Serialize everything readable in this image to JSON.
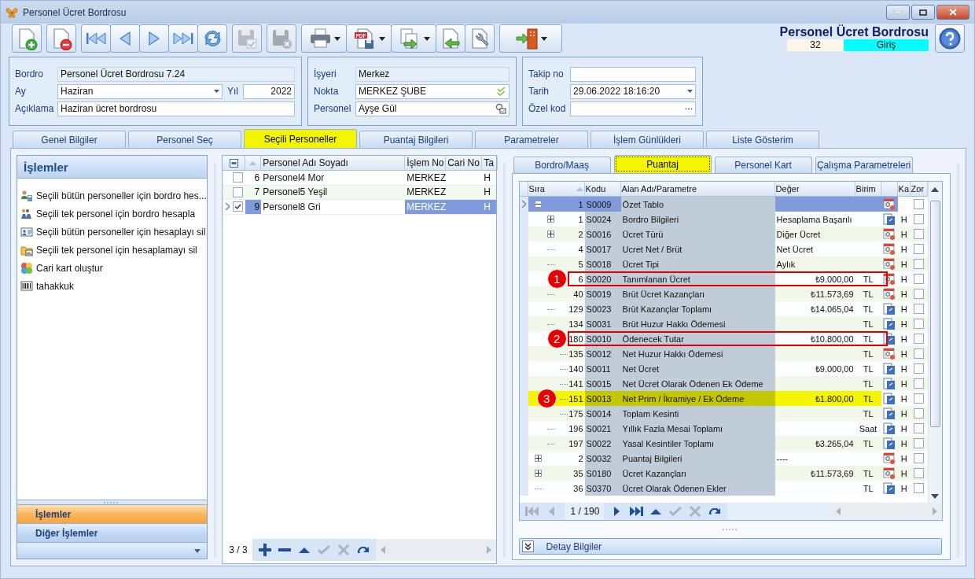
{
  "window": {
    "title": "Personel Ücret Bordrosu"
  },
  "toolbar": [
    [
      {
        "kind": "new",
        "disabled": false
      }
    ],
    [
      {
        "kind": "delete",
        "disabled": false
      }
    ],
    [
      {
        "kind": "first",
        "disabled": false
      },
      {
        "kind": "prev",
        "disabled": false
      },
      {
        "kind": "next",
        "disabled": false
      },
      {
        "kind": "last",
        "disabled": false
      },
      {
        "kind": "refresh",
        "disabled": false
      }
    ],
    [
      {
        "kind": "save",
        "disabled": true
      }
    ],
    [
      {
        "kind": "discard",
        "disabled": true
      }
    ],
    [
      {
        "kind": "print",
        "disabled": false,
        "dropdown": true
      },
      {
        "kind": "pdf",
        "disabled": false,
        "dropdown": true,
        "badge": "PDF"
      },
      {
        "kind": "export",
        "disabled": false,
        "dropdown": true
      },
      {
        "kind": "import",
        "disabled": false
      },
      {
        "kind": "tools",
        "disabled": false
      }
    ],
    [
      {
        "kind": "exit",
        "disabled": false,
        "dropdown": true
      }
    ]
  ],
  "header": {
    "title": "Personel Ücret Bordrosu",
    "record": "32",
    "mode": "Giriş"
  },
  "form_panels": [
    {
      "rows": [
        [
          {
            "label": "Bordro",
            "value": "Personel Ücret Bordrosu 7.24",
            "kind": "readonly"
          }
        ],
        [
          {
            "label": "Ay",
            "value": "Haziran",
            "kind": "dropdown"
          },
          {
            "label": "Yıl",
            "value": "2022",
            "kind": "number"
          }
        ],
        [
          {
            "label": "Açıklama",
            "value": "Haziran ücret bordrosu",
            "kind": "text"
          }
        ]
      ]
    },
    {
      "rows": [
        [
          {
            "label": "İşyeri",
            "value": "Merkez",
            "kind": "readonly"
          }
        ],
        [
          {
            "label": "Nokta",
            "value": "MERKEZ ŞUBE",
            "kind": "check"
          }
        ],
        [
          {
            "label": "Personel",
            "value": "Ayşe Gül",
            "kind": "lookup"
          }
        ]
      ]
    },
    {
      "rows": [
        [
          {
            "label": "Takip no",
            "kind": "text"
          }
        ],
        [
          {
            "label": "Tarih",
            "value": "29.06.2022 18:16:20",
            "kind": "dropdown"
          }
        ],
        [
          {
            "label": "Özel kod",
            "kind": "ellipsis"
          }
        ]
      ]
    }
  ],
  "tabs": [
    {
      "label": "Genel Bilgiler",
      "selected": false
    },
    {
      "label": "Personel Seç",
      "selected": false
    },
    {
      "label": "Seçili Personeller",
      "selected": true
    },
    {
      "label": "Puantaj Bilgileri",
      "selected": false
    },
    {
      "label": "Parametreler",
      "selected": false
    },
    {
      "label": "İşlem Günlükleri",
      "selected": false
    },
    {
      "label": "Liste Gösterim",
      "selected": false
    }
  ],
  "actions_panel": {
    "title": "İşlemler",
    "items": [
      "Seçili bütün personeller için bordro hes...",
      "Seçili tek personel için bordro hesapla",
      "Seçili bütün personeller için hesaplayı sil",
      "Seçili tek personel için hesaplamayı sil",
      "Cari kart oluştur",
      "tahakkuk"
    ],
    "groups": [
      {
        "label": "İşlemler",
        "selected": true
      },
      {
        "label": "Diğer İşlemler",
        "selected": false
      }
    ]
  },
  "personnel_grid": {
    "columns": [
      "Personel Adı Soyadı",
      "İşlem No",
      "Cari No",
      "Ta"
    ],
    "rows": [
      {
        "checked": false,
        "selected": false,
        "number": "6",
        "name": "Personel4 Mor",
        "point": "MERKEZ",
        "column_6": "H"
      },
      {
        "checked": false,
        "selected": false,
        "number": "7",
        "name": "Personel5 Yeşil",
        "point": "MERKEZ",
        "column_6": "H"
      },
      {
        "checked": true,
        "selected": true,
        "number": "9",
        "name": "Personel8 Gri",
        "point": "MERKEZ",
        "column_6": "H"
      }
    ],
    "pager": "3 / 3",
    "nav": [
      {
        "kind": "add",
        "disabled": false
      },
      {
        "kind": "remove",
        "disabled": false
      },
      {
        "kind": "up",
        "disabled": false
      },
      {
        "kind": "post",
        "disabled": true
      },
      {
        "kind": "cancel",
        "disabled": true
      },
      {
        "kind": "redo",
        "disabled": false
      }
    ]
  },
  "subtabs": [
    {
      "label": "Bordro/Maaş",
      "selected": false
    },
    {
      "label": "Puantaj",
      "selected": true
    },
    {
      "label": "Personel Kart",
      "selected": false
    },
    {
      "label": "Çalışma Parametreleri",
      "selected": false
    }
  ],
  "puantaj_grid": {
    "columns": [
      "Sıra",
      "Kodu",
      "Alan Adı/Parametre",
      "Değer",
      "Birim",
      "Ka",
      "Zor"
    ],
    "rows": [
      {
        "sira": "1",
        "code": "S0009",
        "name": "Özet Tablo",
        "kind": "calendar",
        "checked": false,
        "selected": true,
        "expanded": true,
        "children": [
          {
            "sira": "1",
            "code": "S0024",
            "name": "Bordro Bilgileri",
            "value": "Hesaplama Başarılı",
            "kind": "sheet",
            "ka": "H",
            "checked": false,
            "selected": false,
            "expanded": false
          },
          {
            "sira": "2",
            "code": "S0016",
            "name": "Ücret Türü",
            "value": "Diğer Ücret",
            "kind": "calendar",
            "ka": "H",
            "checked": false,
            "selected": false,
            "expanded": false
          },
          {
            "sira": "4",
            "code": "S0017",
            "name": "Ucret Net / Brüt",
            "value": "Net Ücret",
            "kind": "calendar",
            "ka": "H",
            "checked": false,
            "selected": false
          },
          {
            "sira": "5",
            "code": "S0018",
            "name": "Ücret Tipi",
            "value": "Aylık",
            "kind": "calendar",
            "ka": "H",
            "checked": false,
            "selected": false
          },
          {
            "sira": "6",
            "code": "S0020",
            "name": "Tanımlanan Ücret",
            "value": "₺9.000,00",
            "unit": "TL",
            "kind": "calendar",
            "ka": "H",
            "checked": false,
            "selected": false,
            "callout": "1",
            "outlined": true,
            "highlighted": false
          },
          {
            "sira": "40",
            "code": "S0019",
            "name": "Brüt Ücret Kazançları",
            "value": "₺11.573,69",
            "unit": "TL",
            "kind": "calendar",
            "ka": "H",
            "checked": false,
            "selected": false
          },
          {
            "sira": "129",
            "code": "S0023",
            "name": "Brüt Kazançlar Toplamı",
            "value": "₺14.065,04",
            "unit": "TL",
            "kind": "sheet",
            "ka": "H",
            "checked": false,
            "selected": false
          },
          {
            "sira": "134",
            "code": "S0031",
            "name": "Brüt Huzur Hakkı Ödemesi",
            "unit": "TL",
            "kind": "sheet",
            "ka": "H",
            "checked": false,
            "selected": false
          },
          {
            "sira": "180",
            "code": "S0010",
            "name": "Ödenecek Tutar",
            "value": "₺10.800,00",
            "unit": "TL",
            "kind": "sheet",
            "ka": "H",
            "checked": false,
            "selected": false,
            "callout": "2",
            "outlined": true,
            "highlighted": false,
            "children": [
              {
                "sira": "135",
                "code": "S0012",
                "name": "Net Huzur Hakkı Ödemesi",
                "unit": "TL",
                "kind": "calendar",
                "ka": "H",
                "checked": false,
                "selected": false
              },
              {
                "sira": "140",
                "code": "S0011",
                "name": "Net Ücret",
                "value": "₺9.000,00",
                "unit": "TL",
                "kind": "sheet",
                "ka": "H",
                "checked": false,
                "selected": false
              },
              {
                "sira": "141",
                "code": "S0015",
                "name": "Net Ücret Olarak Ödenen Ek Ödeme",
                "unit": "TL",
                "kind": "sheet",
                "ka": "H",
                "checked": false,
                "selected": false
              },
              {
                "sira": "151",
                "code": "S0013",
                "name": "Net Prim / İkramiye / Ek Ödeme",
                "value": "₺1.800,00",
                "unit": "TL",
                "kind": "sheet",
                "ka": "H",
                "checked": false,
                "selected": false,
                "callout": "3",
                "outlined": false,
                "highlighted": true
              },
              {
                "sira": "175",
                "code": "S0014",
                "name": "Toplam Kesinti",
                "unit": "TL",
                "kind": "sheet",
                "ka": "H",
                "checked": false,
                "selected": false
              }
            ]
          },
          {
            "sira": "196",
            "code": "S0021",
            "name": "Yıllık Fazla Mesai Toplamı",
            "unit": "Saat",
            "kind": "sheet",
            "ka": "H",
            "checked": false,
            "selected": false
          },
          {
            "sira": "197",
            "code": "S0022",
            "name": "Yasal Kesintiler Toplamı",
            "value": "₺3.265,04",
            "unit": "TL",
            "kind": "sheet",
            "ka": "H",
            "checked": false,
            "selected": false
          }
        ]
      },
      {
        "sira": "2",
        "code": "S0032",
        "name": "Puantaj Bilgileri",
        "value": "----",
        "kind": "calendar",
        "ka": "H",
        "checked": false,
        "selected": false,
        "expanded": false
      },
      {
        "sira": "35",
        "code": "S0180",
        "name": "Ücret Kazançları",
        "value": "₺11.573,69",
        "unit": "TL",
        "kind": "calendar",
        "ka": "H",
        "checked": false,
        "selected": false,
        "expanded": false
      },
      {
        "sira": "36",
        "code": "S0370",
        "name": "Ücret Olarak Ödenen Ekler",
        "unit": "TL",
        "kind": "sheet",
        "ka": "H",
        "checked": false,
        "selected": false
      }
    ],
    "pager": "1 / 190",
    "nav": [
      {
        "kind": "first",
        "disabled": true
      },
      {
        "kind": "prev",
        "disabled": true
      },
      {
        "kind": "next",
        "disabled": false
      },
      {
        "kind": "last",
        "disabled": false
      },
      {
        "kind": "up",
        "disabled": false
      },
      {
        "kind": "post",
        "disabled": true
      },
      {
        "kind": "cancel",
        "disabled": true
      },
      {
        "kind": "redo",
        "disabled": false
      }
    ]
  },
  "detail_bar": {
    "label": "Detay Bilgiler",
    "expanded": false
  }
}
